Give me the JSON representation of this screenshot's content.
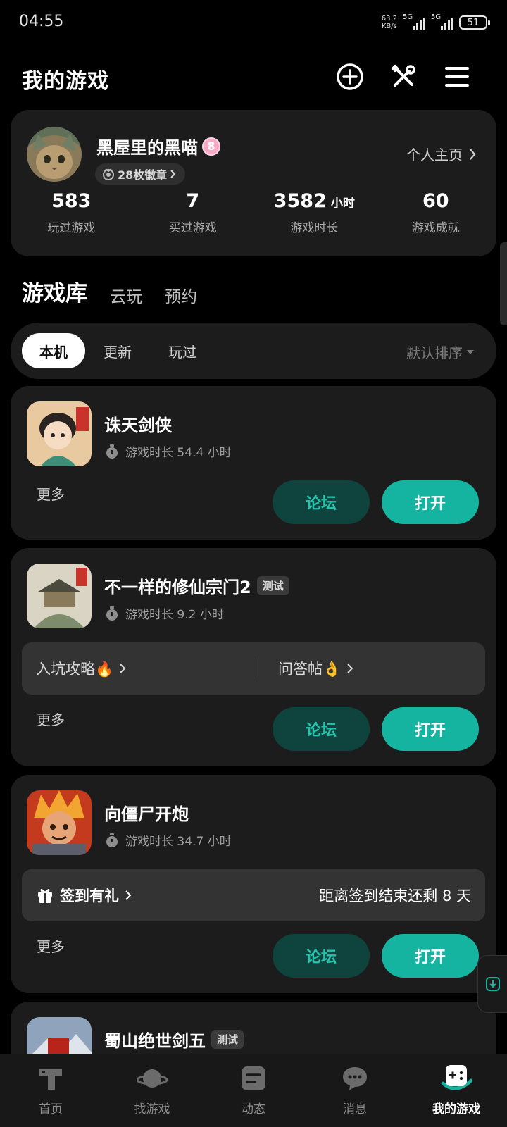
{
  "status_bar": {
    "time": "04:55",
    "net_speed_value": "63.2",
    "net_speed_unit": "KB/s",
    "signal_1": "5G",
    "signal_2": "5G",
    "battery": "51"
  },
  "header": {
    "title": "我的游戏"
  },
  "profile": {
    "username": "黑屋里的黑喵",
    "level": "8",
    "medals": "28枚徽章",
    "home_link": "个人主页",
    "stats": [
      {
        "value": "583",
        "unit": "",
        "label": "玩过游戏"
      },
      {
        "value": "7",
        "unit": "",
        "label": "买过游戏"
      },
      {
        "value": "3582",
        "unit": "小时",
        "label": "游戏时长"
      },
      {
        "value": "60",
        "unit": "",
        "label": "游戏成就"
      }
    ]
  },
  "main_tabs": [
    "游戏库",
    "云玩",
    "预约"
  ],
  "filters": {
    "chips": [
      "本机",
      "更新",
      "玩过"
    ],
    "sort": "默认排序"
  },
  "games": [
    {
      "name": "诛天剑侠",
      "tag": "",
      "play_time": "游戏时长 54.4 小时",
      "more": "更多",
      "forum": "论坛",
      "open": "打开"
    },
    {
      "name": "不一样的修仙宗门2",
      "tag": "测试",
      "play_time": "游戏时长 9.2 小时",
      "guide": "入坑攻略🔥",
      "qa": "问答帖👌",
      "more": "更多",
      "forum": "论坛",
      "open": "打开"
    },
    {
      "name": "向僵尸开炮",
      "tag": "",
      "play_time": "游戏时长 34.7 小时",
      "checkin": "签到有礼",
      "checkin_remaining": "距离签到结束还剩 8 天",
      "more": "更多",
      "forum": "论坛",
      "open": "打开"
    },
    {
      "name": "蜀山绝世剑五",
      "tag": "测试"
    }
  ],
  "bottom_nav": [
    "首页",
    "找游戏",
    "动态",
    "消息",
    "我的游戏"
  ],
  "colors": {
    "accent": "#15b4a0",
    "forum_bg": "#0f433d",
    "card_bg": "#1c1c1c",
    "page_bg": "#000000"
  }
}
